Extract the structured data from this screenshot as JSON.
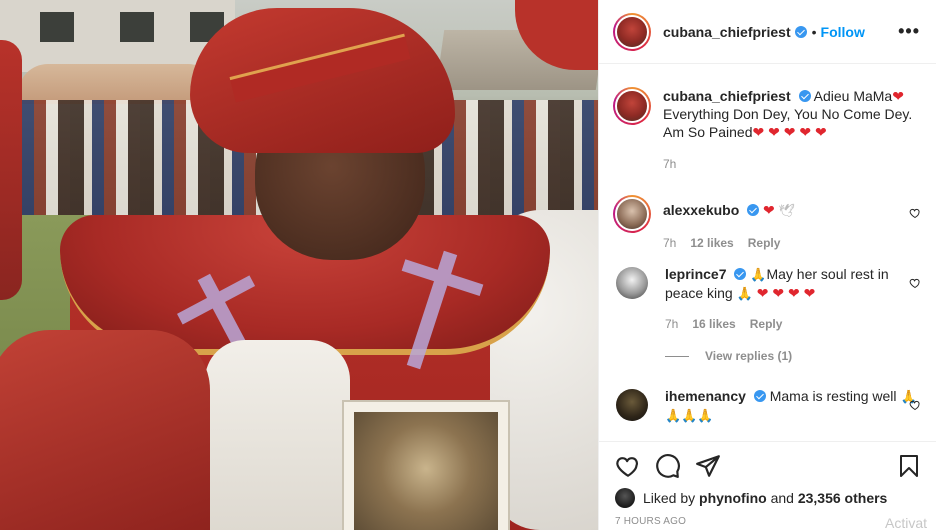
{
  "post": {
    "username": "cubana_chiefpriest",
    "verified": true,
    "follow_label": "Follow",
    "dot": "•",
    "more_icon": "more-options-icon",
    "photo_alt": "Post photo"
  },
  "caption": {
    "username": "cubana_chiefpriest",
    "text_lines": [
      "Adieu MaMa",
      "Everything Don Dey, You No Come Dey. Am So Pained"
    ],
    "time": "7h"
  },
  "comments": [
    {
      "username": "alexxekubo",
      "text": "",
      "time": "7h",
      "likes": "12 likes",
      "reply_label": "Reply"
    },
    {
      "username": "leprince7",
      "text_a": "May her soul rest in peace king",
      "time": "7h",
      "likes": "16 likes",
      "reply_label": "Reply",
      "view_replies": "View replies (1)"
    },
    {
      "username": "ihemenancy",
      "text": "Mama is resting well"
    }
  ],
  "actions": {
    "liked_by_prefix": "Liked by",
    "liked_by_user": "phynofino",
    "liked_by_conj": "and",
    "liked_by_count": "23,356 others",
    "timestamp": "7 HOURS AGO",
    "watermark": "Activat"
  },
  "colors": {
    "accent": "#0095f6",
    "verified": "#3897f0",
    "heart": "#e0262e",
    "muted": "#8e8e8e"
  }
}
